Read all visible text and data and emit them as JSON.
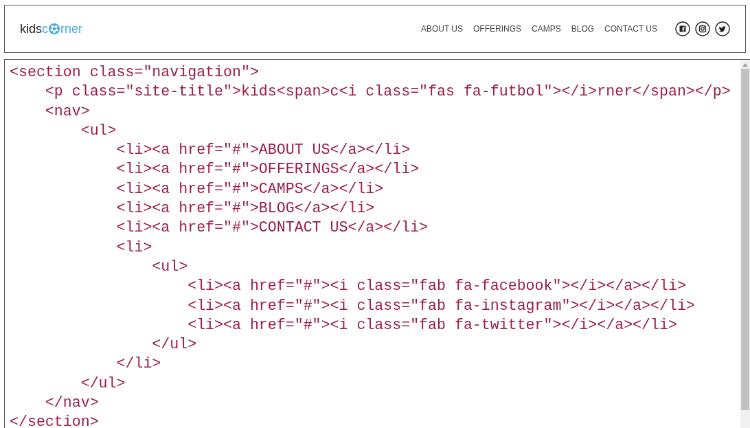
{
  "site_header": {
    "logo": {
      "prefix": "kids",
      "letter": "c",
      "suffix": "rner"
    },
    "nav": [
      {
        "label": "ABOUT US"
      },
      {
        "label": "OFFERINGS"
      },
      {
        "label": "CAMPS"
      },
      {
        "label": "BLOG"
      },
      {
        "label": "CONTACT US"
      }
    ],
    "social": [
      {
        "kind": "facebook"
      },
      {
        "kind": "instagram"
      },
      {
        "kind": "twitter"
      }
    ]
  },
  "code": {
    "lines": [
      "<section class=\"navigation\">",
      "    <p class=\"site-title\">kids<span>c<i class=\"fas fa-futbol\"></i>rner</span></p>",
      "    <nav>",
      "        <ul>",
      "            <li><a href=\"#\">ABOUT US</a></li>",
      "            <li><a href=\"#\">OFFERINGS</a></li>",
      "            <li><a href=\"#\">CAMPS</a></li>",
      "            <li><a href=\"#\">BLOG</a></li>",
      "            <li><a href=\"#\">CONTACT US</a></li>",
      "            <li>",
      "                <ul>",
      "                    <li><a href=\"#\"><i class=\"fab fa-facebook\"></i></a></li>",
      "                    <li><a href=\"#\"><i class=\"fab fa-instagram\"></i></a></li>",
      "                    <li><a href=\"#\"><i class=\"fab fa-twitter\"></i></a></li>",
      "                </ul>",
      "            </li>",
      "        </ul>",
      "    </nav>",
      "</section>"
    ]
  }
}
